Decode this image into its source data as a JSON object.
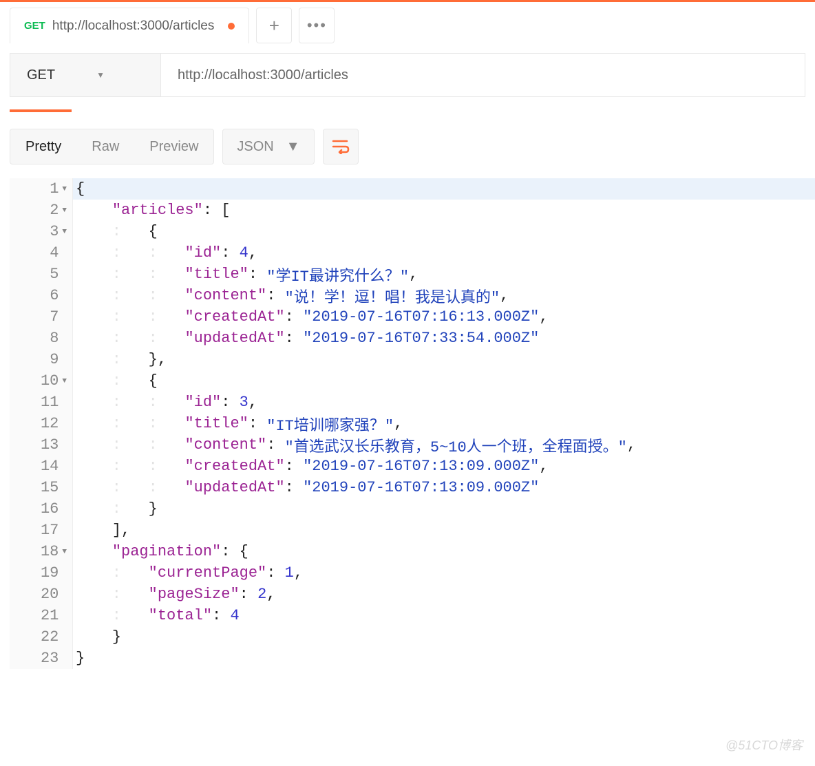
{
  "tab": {
    "method": "GET",
    "title": "http://localhost:3000/articles",
    "unsaved": true
  },
  "request": {
    "method": "GET",
    "url": "http://localhost:3000/articles"
  },
  "viewModes": {
    "pretty": "Pretty",
    "raw": "Raw",
    "preview": "Preview"
  },
  "formatSelect": "JSON",
  "responseBody": {
    "articles": [
      {
        "id": 4,
        "title": "学IT最讲究什么？",
        "content": "说！学！逗！唱！我是认真的",
        "createdAt": "2019-07-16T07:16:13.000Z",
        "updatedAt": "2019-07-16T07:33:54.000Z"
      },
      {
        "id": 3,
        "title": "IT培训哪家强？",
        "content": "首选武汉长乐教育，5~10人一个班，全程面授。",
        "createdAt": "2019-07-16T07:13:09.000Z",
        "updatedAt": "2019-07-16T07:13:09.000Z"
      }
    ],
    "pagination": {
      "currentPage": 1,
      "pageSize": 2,
      "total": 4
    }
  },
  "lineNumbers": [
    "1",
    "2",
    "3",
    "4",
    "5",
    "6",
    "7",
    "8",
    "9",
    "10",
    "11",
    "12",
    "13",
    "14",
    "15",
    "16",
    "17",
    "18",
    "19",
    "20",
    "21",
    "22",
    "23"
  ],
  "foldMarks": {
    "1": true,
    "2": true,
    "3": true,
    "10": true,
    "18": true
  },
  "codeLines": [
    [
      [
        "p",
        "{"
      ]
    ],
    [
      [
        "g",
        "    "
      ],
      [
        "k",
        "\"articles\""
      ],
      [
        "p",
        ": ["
      ]
    ],
    [
      [
        "g",
        "    :   "
      ],
      [
        "p",
        "{"
      ]
    ],
    [
      [
        "g",
        "    :   :   "
      ],
      [
        "k",
        "\"id\""
      ],
      [
        "p",
        ": "
      ],
      [
        "n",
        "4"
      ],
      [
        "p",
        ","
      ]
    ],
    [
      [
        "g",
        "    :   :   "
      ],
      [
        "k",
        "\"title\""
      ],
      [
        "p",
        ": "
      ],
      [
        "s",
        "\"学IT最讲究什么？\""
      ],
      [
        "p",
        ","
      ]
    ],
    [
      [
        "g",
        "    :   :   "
      ],
      [
        "k",
        "\"content\""
      ],
      [
        "p",
        ": "
      ],
      [
        "s",
        "\"说！学！逗！唱！我是认真的\""
      ],
      [
        "p",
        ","
      ]
    ],
    [
      [
        "g",
        "    :   :   "
      ],
      [
        "k",
        "\"createdAt\""
      ],
      [
        "p",
        ": "
      ],
      [
        "s",
        "\"2019-07-16T07:16:13.000Z\""
      ],
      [
        "p",
        ","
      ]
    ],
    [
      [
        "g",
        "    :   :   "
      ],
      [
        "k",
        "\"updatedAt\""
      ],
      [
        "p",
        ": "
      ],
      [
        "s",
        "\"2019-07-16T07:33:54.000Z\""
      ]
    ],
    [
      [
        "g",
        "    :   "
      ],
      [
        "p",
        "},"
      ]
    ],
    [
      [
        "g",
        "    :   "
      ],
      [
        "p",
        "{"
      ]
    ],
    [
      [
        "g",
        "    :   :   "
      ],
      [
        "k",
        "\"id\""
      ],
      [
        "p",
        ": "
      ],
      [
        "n",
        "3"
      ],
      [
        "p",
        ","
      ]
    ],
    [
      [
        "g",
        "    :   :   "
      ],
      [
        "k",
        "\"title\""
      ],
      [
        "p",
        ": "
      ],
      [
        "s",
        "\"IT培训哪家强？\""
      ],
      [
        "p",
        ","
      ]
    ],
    [
      [
        "g",
        "    :   :   "
      ],
      [
        "k",
        "\"content\""
      ],
      [
        "p",
        ": "
      ],
      [
        "s",
        "\"首选武汉长乐教育，5~10人一个班，全程面授。\""
      ],
      [
        "p",
        ","
      ]
    ],
    [
      [
        "g",
        "    :   :   "
      ],
      [
        "k",
        "\"createdAt\""
      ],
      [
        "p",
        ": "
      ],
      [
        "s",
        "\"2019-07-16T07:13:09.000Z\""
      ],
      [
        "p",
        ","
      ]
    ],
    [
      [
        "g",
        "    :   :   "
      ],
      [
        "k",
        "\"updatedAt\""
      ],
      [
        "p",
        ": "
      ],
      [
        "s",
        "\"2019-07-16T07:13:09.000Z\""
      ]
    ],
    [
      [
        "g",
        "    :   "
      ],
      [
        "p",
        "}"
      ]
    ],
    [
      [
        "g",
        "    "
      ],
      [
        "p",
        "],"
      ]
    ],
    [
      [
        "g",
        "    "
      ],
      [
        "k",
        "\"pagination\""
      ],
      [
        "p",
        ": {"
      ]
    ],
    [
      [
        "g",
        "    :   "
      ],
      [
        "k",
        "\"currentPage\""
      ],
      [
        "p",
        ": "
      ],
      [
        "n",
        "1"
      ],
      [
        "p",
        ","
      ]
    ],
    [
      [
        "g",
        "    :   "
      ],
      [
        "k",
        "\"pageSize\""
      ],
      [
        "p",
        ": "
      ],
      [
        "n",
        "2"
      ],
      [
        "p",
        ","
      ]
    ],
    [
      [
        "g",
        "    :   "
      ],
      [
        "k",
        "\"total\""
      ],
      [
        "p",
        ": "
      ],
      [
        "n",
        "4"
      ]
    ],
    [
      [
        "g",
        "    "
      ],
      [
        "p",
        "}"
      ]
    ],
    [
      [
        "p",
        "}"
      ]
    ]
  ],
  "watermark": "@51CTO博客"
}
